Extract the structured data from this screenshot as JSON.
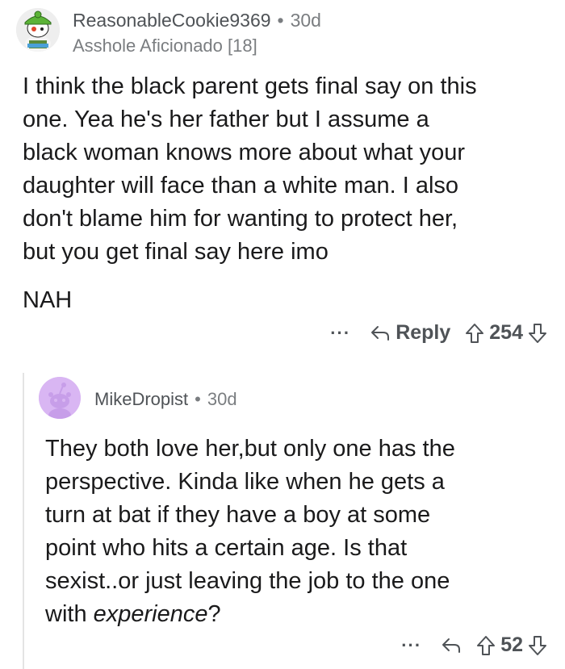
{
  "comment1": {
    "username": "ReasonableCookie9369",
    "age": "30d",
    "flair": "Asshole Aficionado [18]",
    "body_lines": [
      "I think the black parent gets final say on this",
      "one. Yea he's her father but I assume a",
      "black woman knows more about what your",
      "daughter will face than a white man. I also",
      "don't blame him for wanting to protect her,",
      "but you get final say here imo"
    ],
    "verdict": "NAH",
    "actions": {
      "more": "···",
      "reply_label": "Reply",
      "score": "254"
    }
  },
  "comment2": {
    "username": "MikeDropist",
    "age": "30d",
    "body_lines": [
      "They both love her,but only one has the",
      "perspective. Kinda like when he gets a",
      "turn at bat if they have a boy at some",
      "point who hits a certain age. Is that",
      "sexist..or just leaving the job to the one"
    ],
    "body_last_prefix": "with ",
    "body_last_emphasis": "experience",
    "body_last_suffix": "?",
    "actions": {
      "more": "···",
      "score": "52"
    }
  },
  "colors": {
    "text": "#1a1a1b",
    "meta": "#7a7d80",
    "avatar2_bg": "#d9b6f3",
    "thread_line": "#e4e4e4"
  },
  "icons": {
    "avatar1": "snoo-avatar-green-hat",
    "avatar2": "default-snoo-avatar",
    "reply": "reply-arrow-icon",
    "upvote": "upvote-arrow-icon",
    "downvote": "downvote-arrow-icon"
  }
}
